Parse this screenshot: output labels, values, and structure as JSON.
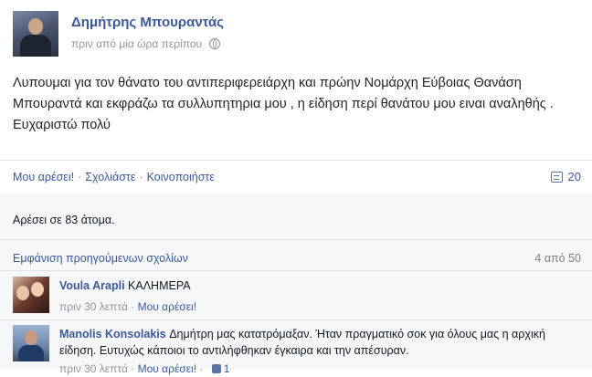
{
  "post": {
    "author": "Δημήτρης Μπουραντάς",
    "time": "πριν από μία ώρα περίπου",
    "text": "Λυπουμαι για τον θάνατο του αντιπεριφερειάρχη και πρώην Νομάρχη Εύβοιας Θανάση Μπουραντά και εκφράζω τα συλλυπητηρια μου , η είδηση περί θανάτου μου ειναι αναληθής . Ευχαριστώ πολύ"
  },
  "actions": {
    "like": "Μου αρέσει!",
    "comment": "Σχολιάστε",
    "share": "Κοινοποιήστε",
    "share_count": "20"
  },
  "likes": {
    "text": "Αρέσει σε 83 άτομα."
  },
  "comments": {
    "show_previous": "Εμφάνιση προηγούμενων σχολίων",
    "counter": "4 από 50",
    "items": [
      {
        "name": "Voula Arapli",
        "text": "ΚΑΛΗΜΕΡΑ",
        "time": "πριν 30 λεπτά",
        "like": "Μου αρέσει!"
      },
      {
        "name": "Manolis Konsolakis",
        "text": "Δημήτρη μας κατατρόμαξαν. Ήταν πραγματικό σοκ για όλους μας η αρχική είδηση. Ευτυχώς κάποιοι το αντιλήφθηκαν έγκαιρα και την απέσυραν.",
        "time": "πριν 30 λεπτά",
        "like": "Μου αρέσει!",
        "like_count": "1"
      }
    ]
  },
  "icons": {
    "audience": "globe-icon",
    "shares": "share-icon",
    "comment_like": "thumb-icon"
  },
  "colors": {
    "link": "#3b5998",
    "meta": "#90949c",
    "feedback_bg": "#f6f7f9"
  }
}
